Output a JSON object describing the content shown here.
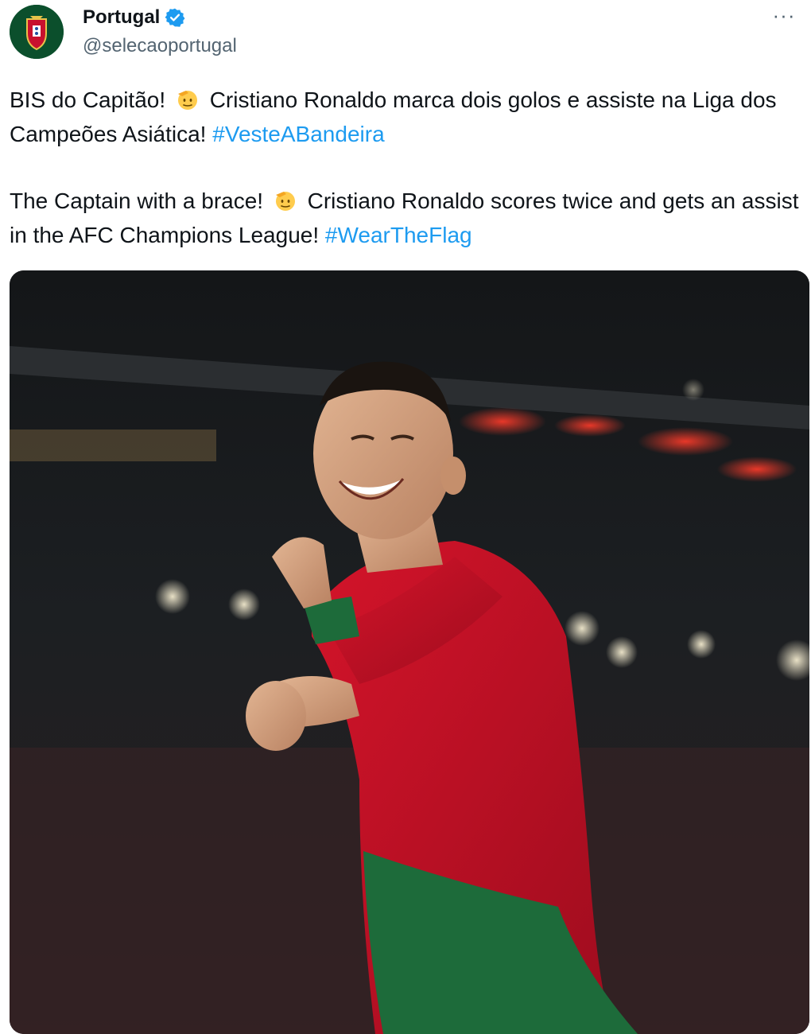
{
  "account": {
    "display_name": "Portugal",
    "handle": "@selecaoportugal",
    "avatar_icon": "portugal-federation-crest",
    "verified_icon": "verified-badge-icon",
    "verified_color": "#1d9bf0"
  },
  "menu": {
    "more_label": "···"
  },
  "tweet": {
    "pt": {
      "text_before": "BIS do Capitão!",
      "text_after": "Cristiano Ronaldo marca dois golos e assiste na Liga dos Campeões Asiática!",
      "hashtag": "#VesteABandeira"
    },
    "en": {
      "text_before": "The Captain with a brace!",
      "text_after": "Cristiano Ronaldo scores twice and gets an assist in the AFC Champions League!",
      "hashtag": "#WearTheFlag"
    },
    "emoji_icon": "saluting-face-emoji"
  },
  "colors": {
    "hashtag": "#1d9bf0",
    "text": "#0f1419",
    "secondary": "#536471",
    "jersey_red": "#c8102e",
    "jersey_green": "#1d6b3a"
  }
}
